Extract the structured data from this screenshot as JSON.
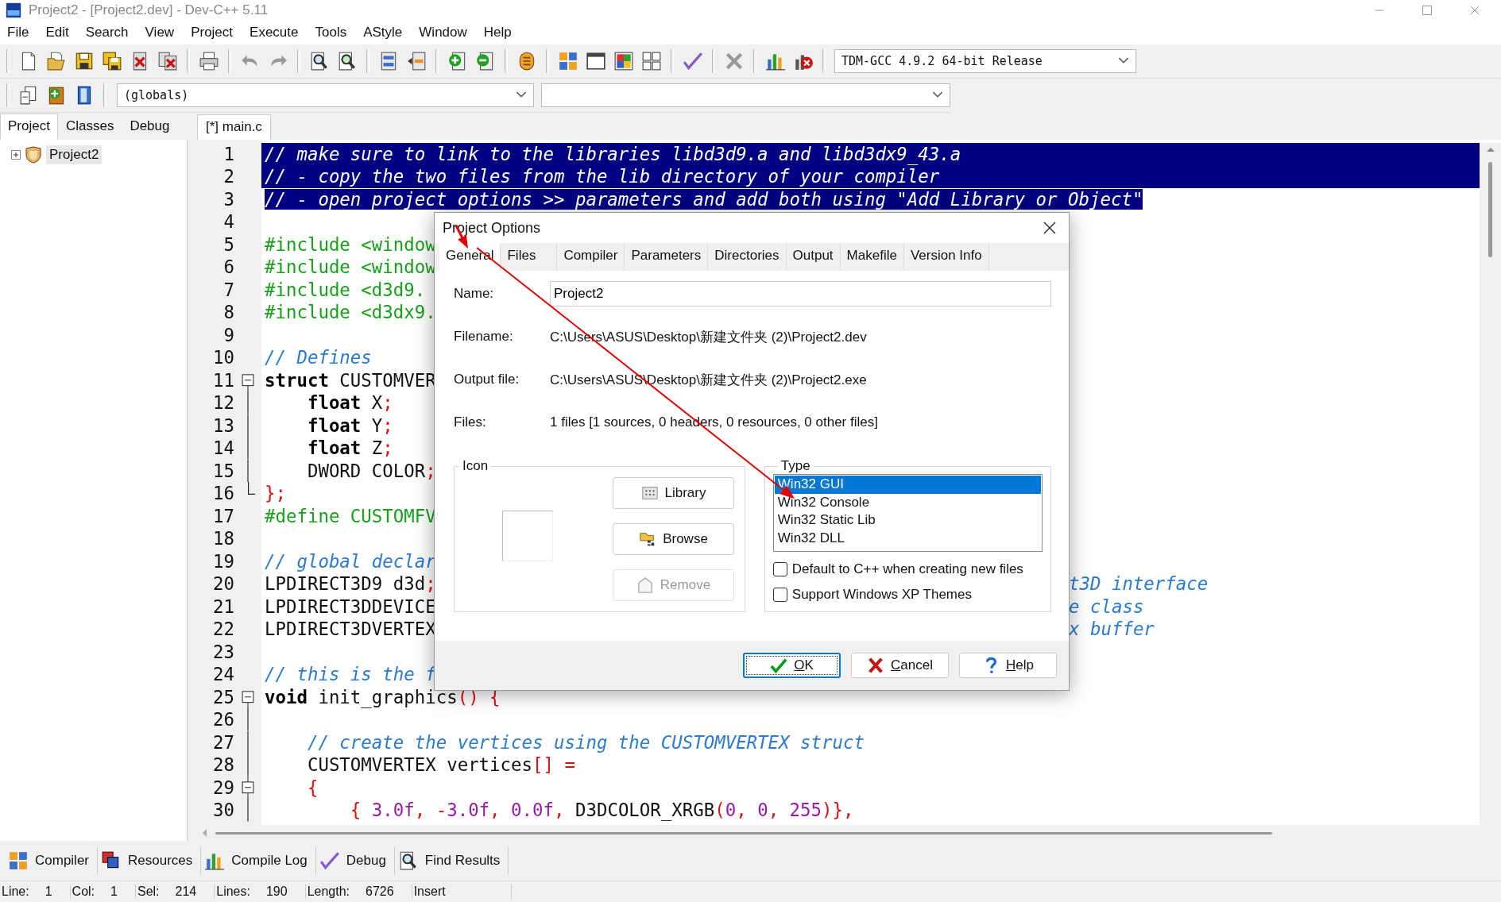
{
  "window": {
    "title": "Project2 - [Project2.dev] - Dev-C++ 5.11"
  },
  "menu": [
    "File",
    "Edit",
    "Search",
    "View",
    "Project",
    "Execute",
    "Tools",
    "AStyle",
    "Window",
    "Help"
  ],
  "toolbar": {
    "compiler": "TDM-GCC 4.9.2 64-bit Release",
    "scope": "(globals)"
  },
  "left_tabs": [
    {
      "label": "Project",
      "selected": true
    },
    {
      "label": "Classes",
      "selected": false
    },
    {
      "label": "Debug",
      "selected": false
    }
  ],
  "project_tree": [
    {
      "label": "Project2",
      "expanded": false,
      "selected": true
    }
  ],
  "editor_tabs": [
    {
      "label": "[*] main.c",
      "selected": true
    }
  ],
  "code_lines": [
    {
      "num": "1",
      "selected": true,
      "code": [
        {
          "kind": "comment",
          "text": "// make sure to link to the libraries libd3d9.a and libd3dx9_43.a"
        }
      ]
    },
    {
      "num": "2",
      "selected": true,
      "code": [
        {
          "kind": "comment",
          "text": "// - copy the two files from the lib directory of your compiler"
        }
      ]
    },
    {
      "num": "3",
      "selected": true,
      "code": [
        {
          "kind": "comment",
          "text": "// - open project options >> parameters and add both using \"Add Library or Object\""
        }
      ]
    },
    {
      "num": "4",
      "selected": false
    },
    {
      "num": "5",
      "selected": false,
      "code": [
        {
          "kind": "preproc",
          "text": "#include <window"
        }
      ]
    },
    {
      "num": "6",
      "selected": false,
      "code": [
        {
          "kind": "preproc",
          "text": "#include <window"
        }
      ]
    },
    {
      "num": "7",
      "selected": false,
      "code": [
        {
          "kind": "preproc",
          "text": "#include <d3d9."
        }
      ]
    },
    {
      "num": "8",
      "selected": false,
      "code": [
        {
          "kind": "preproc",
          "text": "#include <d3dx9."
        }
      ]
    },
    {
      "num": "9",
      "selected": false
    },
    {
      "num": "10",
      "selected": false,
      "code": [
        {
          "kind": "comment",
          "text": "// Defines"
        }
      ]
    },
    {
      "num": "11",
      "selected": false,
      "kind": "start",
      "code": [
        {
          "kind": "keyword",
          "text": "struct"
        },
        {
          "kind": "plain",
          "text": " CUSTOMVER"
        }
      ]
    },
    {
      "num": "12",
      "selected": false,
      "kind": "body",
      "code": [
        {
          "kind": "keyword",
          "text": "    float"
        },
        {
          "kind": "plain",
          "text": " X"
        },
        {
          "kind": "symbol",
          "text": ";"
        }
      ]
    },
    {
      "num": "13",
      "selected": false,
      "kind": "body",
      "code": [
        {
          "kind": "keyword",
          "text": "    float"
        },
        {
          "kind": "plain",
          "text": " Y"
        },
        {
          "kind": "symbol",
          "text": ";"
        }
      ]
    },
    {
      "num": "14",
      "selected": false,
      "kind": "body",
      "code": [
        {
          "kind": "keyword",
          "text": "    float"
        },
        {
          "kind": "plain",
          "text": " Z"
        },
        {
          "kind": "symbol",
          "text": ";"
        }
      ]
    },
    {
      "num": "15",
      "selected": false,
      "kind": "body",
      "code": [
        {
          "kind": "plain",
          "text": "    DWORD COLOR"
        },
        {
          "kind": "symbol",
          "text": ";"
        }
      ]
    },
    {
      "num": "16",
      "selected": false,
      "kind": "end",
      "code": [
        {
          "kind": "symbol",
          "text": "};"
        }
      ]
    },
    {
      "num": "17",
      "selected": false,
      "code": [
        {
          "kind": "preproc",
          "text": "#define CUSTOMFV"
        }
      ]
    },
    {
      "num": "18",
      "selected": false
    },
    {
      "num": "19",
      "selected": false,
      "code": [
        {
          "kind": "comment",
          "text": "// global declar"
        }
      ]
    },
    {
      "num": "20",
      "selected": false,
      "code": [
        {
          "kind": "plain",
          "text": "LPDIRECT3D9 d3d"
        },
        {
          "kind": "symbol",
          "text": ";"
        }
      ],
      "after": [
        {
          "kind": "comment",
          "text": "t3D interface"
        }
      ]
    },
    {
      "num": "21",
      "selected": false,
      "code": [
        {
          "kind": "plain",
          "text": "LPDIRECT3DDEVICE"
        }
      ],
      "after": [
        {
          "kind": "comment",
          "text": "e class"
        }
      ]
    },
    {
      "num": "22",
      "selected": false,
      "code": [
        {
          "kind": "plain",
          "text": "LPDIRECT3DVERTEX"
        }
      ],
      "after": [
        {
          "kind": "comment",
          "text": "x buffer"
        }
      ]
    },
    {
      "num": "23",
      "selected": false
    },
    {
      "num": "24",
      "selected": false,
      "code": [
        {
          "kind": "comment",
          "text": "// this is the f"
        }
      ]
    },
    {
      "num": "25",
      "selected": false,
      "kind": "start",
      "code": [
        {
          "kind": "keyword",
          "text": "void"
        },
        {
          "kind": "plain",
          "text": " init_graphics"
        },
        {
          "kind": "symbol",
          "text": "() {"
        }
      ]
    },
    {
      "num": "26",
      "selected": false,
      "kind": "body"
    },
    {
      "num": "27",
      "selected": false,
      "kind": "body",
      "code": [
        {
          "kind": "comment",
          "text": "    // create the vertices using the CUSTOMVERTEX struct"
        }
      ]
    },
    {
      "num": "28",
      "selected": false,
      "kind": "body",
      "code": [
        {
          "kind": "plain",
          "text": "    CUSTOMVERTEX vertices"
        },
        {
          "kind": "symbol",
          "text": "[] ="
        }
      ]
    },
    {
      "num": "29",
      "selected": false,
      "kind": "start",
      "code": [
        {
          "kind": "symbol",
          "text": "    {"
        }
      ]
    },
    {
      "num": "30",
      "selected": false,
      "kind": "body",
      "code": [
        {
          "kind": "symbol",
          "text": "        { "
        },
        {
          "kind": "number",
          "text": "3.0f"
        },
        {
          "kind": "symbol",
          "text": ", -"
        },
        {
          "kind": "number",
          "text": "3.0f"
        },
        {
          "kind": "symbol",
          "text": ", "
        },
        {
          "kind": "number",
          "text": "0.0f"
        },
        {
          "kind": "symbol",
          "text": ", "
        },
        {
          "kind": "plain",
          "text": "D3DCOLOR_XRGB"
        },
        {
          "kind": "symbol",
          "text": "("
        },
        {
          "kind": "number",
          "text": "0"
        },
        {
          "kind": "symbol",
          "text": ", "
        },
        {
          "kind": "number",
          "text": "0"
        },
        {
          "kind": "symbol",
          "text": ", "
        },
        {
          "kind": "number",
          "text": "255"
        },
        {
          "kind": "symbol",
          "text": ")},"
        }
      ]
    }
  ],
  "dialog": {
    "title": "Project Options",
    "tabs": [
      {
        "label": "General",
        "selected": true
      },
      {
        "label": "Files",
        "selected": false
      },
      {
        "label": "Compiler",
        "selected": false
      },
      {
        "label": "Parameters",
        "selected": false
      },
      {
        "label": "Directories",
        "selected": false
      },
      {
        "label": "Output",
        "selected": false
      },
      {
        "label": "Makefile",
        "selected": false
      },
      {
        "label": "Version Info",
        "selected": false
      }
    ],
    "fields": [
      {
        "label": "Name:",
        "kind": "input",
        "value": "Project2"
      },
      {
        "label": "Filename:",
        "kind": "text",
        "value": "C:\\Users\\ASUS\\Desktop\\新建文件夹 (2)\\Project2.dev"
      },
      {
        "label": "Output file:",
        "kind": "text",
        "value": "C:\\Users\\ASUS\\Desktop\\新建文件夹 (2)\\Project2.exe"
      },
      {
        "label": "Files:",
        "kind": "text",
        "value": "1 files [1 sources, 0 headers, 0 resources, 0 other files]"
      }
    ],
    "icon_group": {
      "title": "Icon",
      "buttons": [
        {
          "label": "Library",
          "disabled": false
        },
        {
          "label": "Browse",
          "disabled": false
        },
        {
          "label": "Remove",
          "disabled": true
        }
      ]
    },
    "type_group": {
      "title": "Type",
      "options": [
        {
          "label": "Win32 GUI",
          "selected": true
        },
        {
          "label": "Win32 Console",
          "selected": false
        },
        {
          "label": "Win32 Static Lib",
          "selected": false
        },
        {
          "label": "Win32 DLL",
          "selected": false
        }
      ],
      "checkboxes": [
        {
          "label": "Default to C++ when creating new files",
          "checked": false
        },
        {
          "label": "Support Windows XP Themes",
          "checked": false
        }
      ]
    },
    "buttons": [
      {
        "label": "OK",
        "default": true
      },
      {
        "label": "Cancel",
        "default": false
      },
      {
        "label": "Help",
        "default": false
      }
    ]
  },
  "bottom_tabs": [
    "Compiler",
    "Resources",
    "Compile Log",
    "Debug",
    "Find Results"
  ],
  "status_bar": [
    {
      "label": "Line:",
      "value": "1"
    },
    {
      "label": "Col:",
      "value": "1"
    },
    {
      "label": "Sel:",
      "value": "214"
    },
    {
      "label": "Lines:",
      "value": "190"
    },
    {
      "label": "Length:",
      "value": "6726"
    },
    {
      "label": "Insert"
    }
  ]
}
